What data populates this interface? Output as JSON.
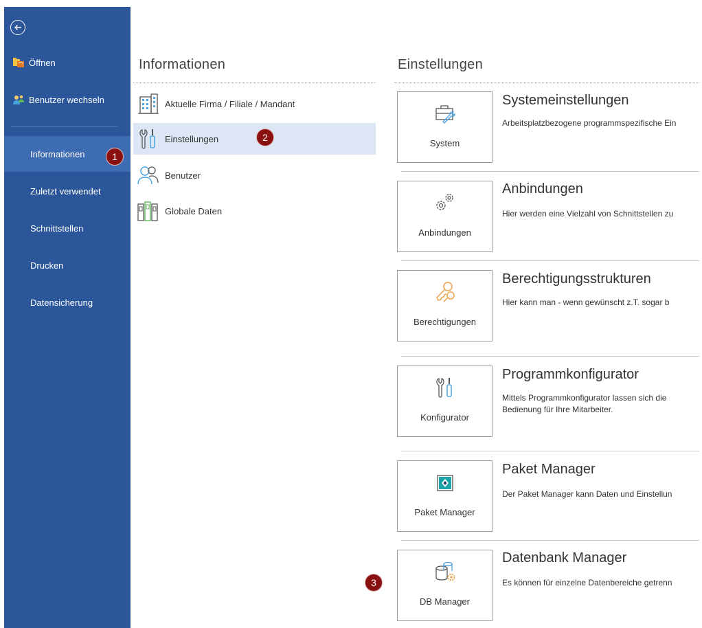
{
  "sidebar": {
    "top_items": [
      {
        "label": "Öffnen",
        "icon": "folder-open-icon"
      },
      {
        "label": "Benutzer wechseln",
        "icon": "switch-user-icon"
      }
    ],
    "nav_items": [
      {
        "label": "Informationen",
        "active": true
      },
      {
        "label": "Zuletzt verwendet"
      },
      {
        "label": "Schnittstellen"
      },
      {
        "label": "Drucken"
      },
      {
        "label": "Datensicherung"
      }
    ],
    "colors": {
      "background": "#2b579a",
      "active": "#3d6cb3"
    }
  },
  "info_column": {
    "title": "Informationen",
    "items": [
      {
        "label": "Aktuelle Firma / Filiale / Mandant",
        "icon": "building-icon"
      },
      {
        "label": "Einstellungen",
        "icon": "wrench-screwdriver-icon",
        "selected": true
      },
      {
        "label": "Benutzer",
        "icon": "users-icon"
      },
      {
        "label": "Globale Daten",
        "icon": "binders-icon"
      }
    ]
  },
  "settings_column": {
    "title": "Einstellungen",
    "entries": [
      {
        "tile": "System",
        "title": "Systemeinstellungen",
        "desc": [
          "Arbeitsplatzbezogene programmspezifische Ein"
        ],
        "icon": "toolbox-icon"
      },
      {
        "tile": "Anbindungen",
        "title": "Anbindungen",
        "desc": [
          "Hier werden eine Vielzahl von Schnittstellen zu"
        ],
        "icon": "gears-icon"
      },
      {
        "tile": "Berechtigungen",
        "title": "Berechtigungsstrukturen",
        "desc": [
          "Hier kann man - wenn gewünscht z.T. sogar b"
        ],
        "icon": "keys-icon"
      },
      {
        "tile": "Konfigurator",
        "title": "Programmkonfigurator",
        "desc": [
          "Mittels Programmkonfigurator lassen sich die",
          "Bedienung für Ihre Mitarbeiter."
        ],
        "icon": "wrench-screwdriver-icon"
      },
      {
        "tile": "Paket Manager",
        "title": "Paket Manager",
        "desc": [
          "Der Paket Manager kann Daten und Einstellun"
        ],
        "icon": "package-icon"
      },
      {
        "tile": "DB Manager",
        "title": "Datenbank Manager",
        "desc": [
          "Es können für einzelne Datenbereiche getrenn"
        ],
        "icon": "database-gear-icon"
      }
    ]
  },
  "badges": [
    "1",
    "2",
    "3"
  ],
  "accent": {
    "badge": "#8b1111",
    "selected_row": "#dce6f4"
  }
}
